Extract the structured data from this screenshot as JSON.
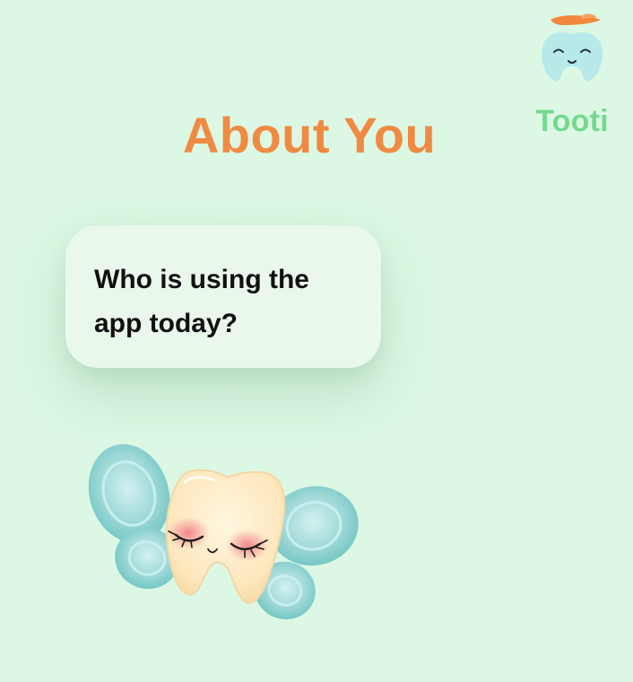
{
  "header": {
    "title": "About You"
  },
  "brand": {
    "name": "Tooti",
    "logo_icon": "tooth-mascot-icon",
    "color": "#74d98f"
  },
  "prompt": {
    "question": "Who is using the app today?"
  },
  "illustration": {
    "icon": "tooth-fairy-icon"
  },
  "colors": {
    "background": "#dcf8e4",
    "title": "#f08a43",
    "bubble": "#eaf7eb"
  }
}
